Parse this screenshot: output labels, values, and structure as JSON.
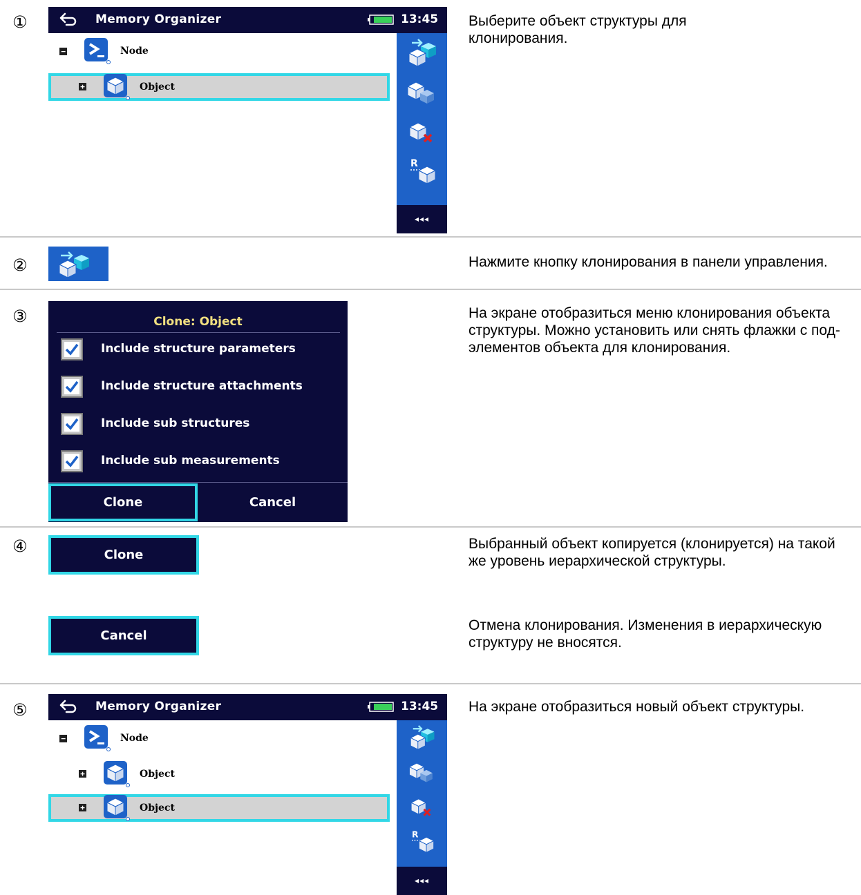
{
  "steps": [
    {
      "num": "①",
      "desc": "Выберите объект структуры для клонирования."
    },
    {
      "num": "②",
      "desc": "Нажмите кнопку клонирования в панели управления."
    },
    {
      "num": "③",
      "desc": "На экране отобразиться меню клонирования объекта структуры. Можно установить или снять флажки с под-элементов объекта для клонирования."
    },
    {
      "num": "④",
      "desc": "Выбранный объект копируется (клонируется) на такой же уровень иерархической структуры.",
      "desc2": "Отмена клонирования. Изменения в иерархическую структуру не вносятся."
    },
    {
      "num": "⑤",
      "desc": "На экране отобразиться новый объект структуры."
    }
  ],
  "screen1": {
    "title": "Memory Organizer",
    "time": "13:45",
    "tree": [
      {
        "label": "Node",
        "type": "node",
        "expanded": true,
        "selected": false
      },
      {
        "label": "Object",
        "type": "object",
        "expanded": false,
        "selected": true
      }
    ],
    "panel": {
      "more_label": "◂◂◂",
      "buttons": [
        "clone-icon",
        "clone-measurement-icon",
        "delete-icon",
        "rename-icon"
      ]
    }
  },
  "screen5": {
    "title": "Memory Organizer",
    "time": "13:45",
    "tree": [
      {
        "label": "Node",
        "type": "node",
        "expanded": true,
        "selected": false
      },
      {
        "label": "Object",
        "type": "object",
        "expanded": false,
        "selected": false
      },
      {
        "label": "Object",
        "type": "object",
        "expanded": false,
        "selected": true
      }
    ],
    "panel": {
      "more_label": "◂◂◂"
    }
  },
  "dialog": {
    "title": "Clone: Object",
    "options": [
      {
        "label": "Include structure parameters",
        "checked": true
      },
      {
        "label": "Include structure attachments",
        "checked": true
      },
      {
        "label": "Include sub structures",
        "checked": true
      },
      {
        "label": "Include sub measurements",
        "checked": true
      }
    ],
    "clone_label": "Clone",
    "cancel_label": "Cancel"
  },
  "step4": {
    "clone_label": "Clone",
    "cancel_label": "Cancel"
  },
  "colors": {
    "dark_navy": "#0b0b3a",
    "panel_blue": "#1e62c8",
    "highlight_cyan": "#32d7e6",
    "title_yellow": "#f2e080",
    "selected_gray": "#d3d3d3"
  }
}
